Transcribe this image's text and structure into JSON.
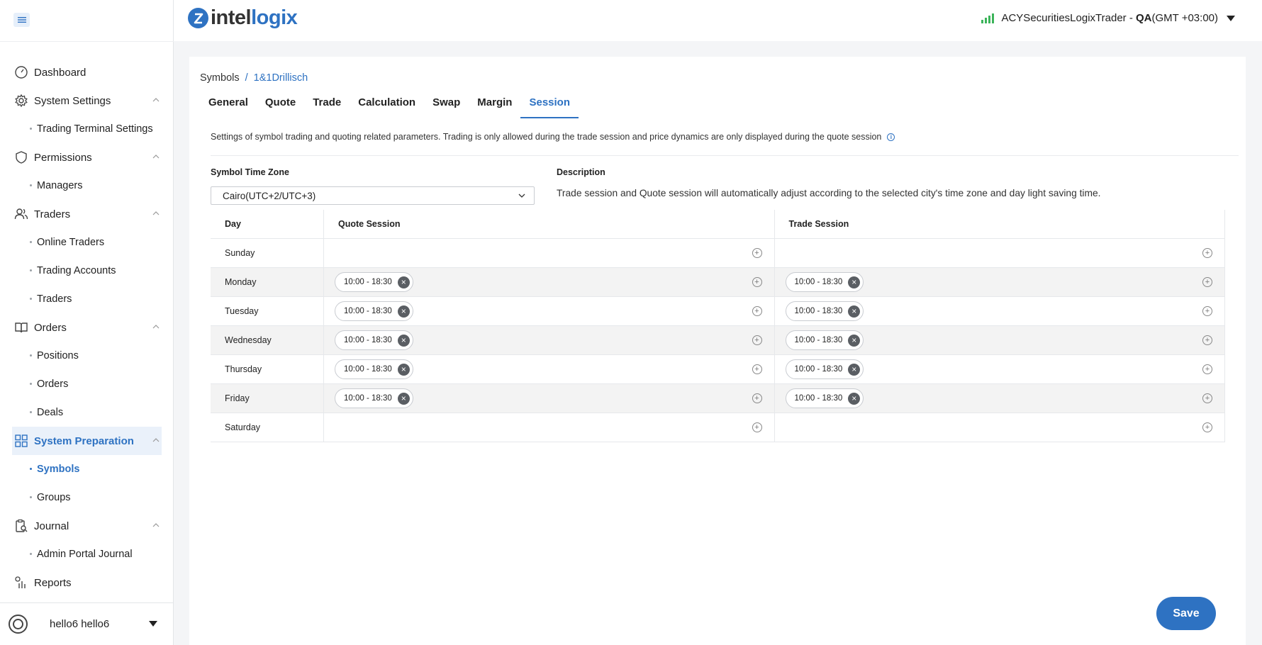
{
  "header": {
    "logo_text_a": "intel",
    "logo_text_b": "logix",
    "server_name": "ACYSecuritiesLogixTrader - ",
    "server_env": "QA",
    "server_tz": "(GMT +03:00)"
  },
  "sidebar": {
    "items": [
      {
        "label": "Dashboard"
      },
      {
        "label": "System Settings"
      },
      {
        "label": "Trading Terminal Settings"
      },
      {
        "label": "Permissions"
      },
      {
        "label": "Managers"
      },
      {
        "label": "Traders"
      },
      {
        "label": "Online Traders"
      },
      {
        "label": "Trading Accounts"
      },
      {
        "label": "Traders"
      },
      {
        "label": "Orders"
      },
      {
        "label": "Positions"
      },
      {
        "label": "Orders"
      },
      {
        "label": "Deals"
      },
      {
        "label": "System Preparation"
      },
      {
        "label": "Symbols"
      },
      {
        "label": "Groups"
      },
      {
        "label": "Journal"
      },
      {
        "label": "Admin Portal Journal"
      },
      {
        "label": "Reports"
      }
    ],
    "user_name": "hello6 hello6"
  },
  "breadcrumb": {
    "root": "Symbols",
    "separator": "/",
    "current": "1&1Drillisch"
  },
  "tabs": [
    "General",
    "Quote",
    "Trade",
    "Calculation",
    "Swap",
    "Margin",
    "Session"
  ],
  "active_tab": "Session",
  "info_text": "Settings of symbol trading and quoting related parameters. Trading is only allowed during the trade session and price dynamics are only displayed during the quote session",
  "timezone": {
    "label": "Symbol Time Zone",
    "value": "Cairo(UTC+2/UTC+3)"
  },
  "description": {
    "label": "Description",
    "text": "Trade session and Quote session will automatically adjust according to the selected city's time zone and day light saving time."
  },
  "table": {
    "headers": {
      "day": "Day",
      "quote": "Quote Session",
      "trade": "Trade Session"
    },
    "rows": [
      {
        "day": "Sunday",
        "quote": [],
        "trade": []
      },
      {
        "day": "Monday",
        "quote": [
          "10:00 - 18:30"
        ],
        "trade": [
          "10:00 - 18:30"
        ]
      },
      {
        "day": "Tuesday",
        "quote": [
          "10:00 - 18:30"
        ],
        "trade": [
          "10:00 - 18:30"
        ]
      },
      {
        "day": "Wednesday",
        "quote": [
          "10:00 - 18:30"
        ],
        "trade": [
          "10:00 - 18:30"
        ]
      },
      {
        "day": "Thursday",
        "quote": [
          "10:00 - 18:30"
        ],
        "trade": [
          "10:00 - 18:30"
        ]
      },
      {
        "day": "Friday",
        "quote": [
          "10:00 - 18:30"
        ],
        "trade": [
          "10:00 - 18:30"
        ]
      },
      {
        "day": "Saturday",
        "quote": [],
        "trade": []
      }
    ]
  },
  "save_label": "Save",
  "colors": {
    "accent": "#2e72c2",
    "signal": "#3cb45a"
  }
}
